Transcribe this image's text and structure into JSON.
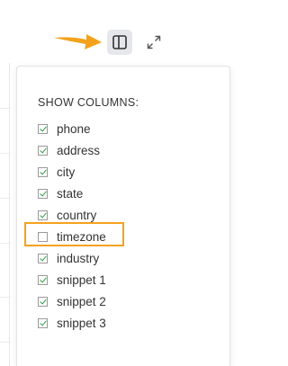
{
  "toolbar": {
    "columns_icon": "columns-toggle-icon",
    "expand_icon": "expand-icon"
  },
  "colors": {
    "accent": "#f4a21d",
    "check": "#2ea043"
  },
  "panel": {
    "title": "SHOW COLUMNS:",
    "columns": [
      {
        "label": "phone",
        "checked": true
      },
      {
        "label": "address",
        "checked": true
      },
      {
        "label": "city",
        "checked": true
      },
      {
        "label": "state",
        "checked": true
      },
      {
        "label": "country",
        "checked": true
      },
      {
        "label": "timezone",
        "checked": false
      },
      {
        "label": "industry",
        "checked": true
      },
      {
        "label": "snippet 1",
        "checked": true
      },
      {
        "label": "snippet 2",
        "checked": true
      },
      {
        "label": "snippet 3",
        "checked": true
      }
    ]
  }
}
